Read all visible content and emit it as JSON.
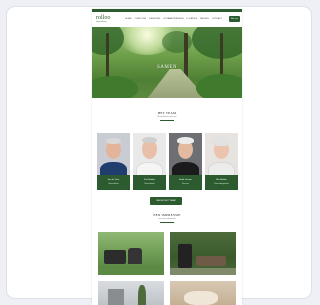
{
  "site": {
    "logo": "rolloo",
    "logo_sub": "uitvaartzorg",
    "nav_items": [
      "Home",
      "Over ons",
      "Diensten",
      "Uitvaartwensen",
      "Locaties",
      "Nieuws",
      "Contact"
    ],
    "nav_button": "Bel ons"
  },
  "hero": {
    "title": "Samen"
  },
  "team": {
    "heading": "Het Team",
    "subheading": "Maak kennis met ons",
    "members": [
      {
        "name": "Jan de Vries",
        "role": "Uitvaartleider"
      },
      {
        "name": "Piet Bakker",
        "role": "Uitvaartleider"
      },
      {
        "name": "Henk Jansen",
        "role": "Directeur"
      },
      {
        "name": "Ria Mulder",
        "role": "Uitvaartbegeleider"
      }
    ],
    "button_label": "Bekijk het team"
  },
  "impressions": {
    "heading": "Een Impressie",
    "subheading": "van onze uitvaarten"
  },
  "colors": {
    "brand_green": "#2c5b30",
    "page_background": "#eef0f5",
    "card_background": "#ffffff"
  },
  "icons": [
    "site-logo"
  ]
}
